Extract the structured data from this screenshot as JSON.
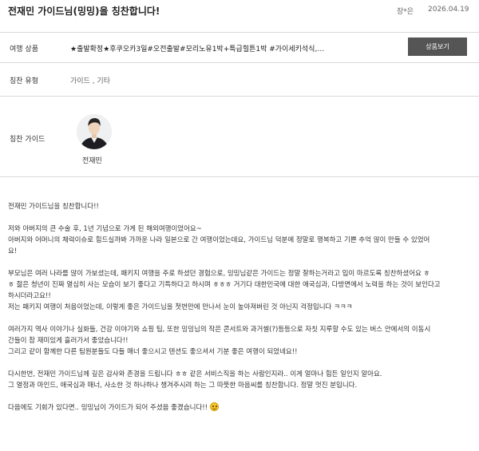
{
  "header": {
    "title": "전재민 가이드님(밍밍)을 칭찬합니다!",
    "author": "장*은",
    "date": "2026.04.19"
  },
  "product": {
    "label": "여행 상품",
    "value": "★출발확정★후쿠오카3일#오전출발#모리노유1박+특급힐튼1박 #가이세키석식,벳...",
    "button_label": "상품보기"
  },
  "praise_type": {
    "label": "칭찬 유형",
    "value": "가이드 , 기타"
  },
  "guide": {
    "label": "칭찬 가이드",
    "name": "전재민"
  },
  "body": {
    "lines": [
      "전재민 가이드님을 칭찬합니다!!",
      "저와 아버지의 큰 수술 후, 1년 기념으로 가게 된 해외여행이었어요~",
      "아버지와 어머니의 체력이슈로 힘드실까봐 가까운 나라 일본으로 간 여행이었는데요, 가이드님 덕분에 정말로 행복하고 기쁜 추억 많이 만들 수 있었어",
      "요!",
      "부모님은 여러 나라를 많이 가보셨는데, 패키지 여행을 주로 하셨던 경험으로, 밍밍님같은 가이드는 정말 잘하는거라고 입이 마르도록 칭찬하셨어요 ㅎ",
      "ㅎ 젊은 청년이 진짜 열심히 사는 모습이 보기 좋다고 기특하다고 하시며 ㅎㅎㅎ 거기다 대한민국에 대한 애국심과, 다방면에서 노력을 하는 것이 보인다고",
      "하시더라고요!!",
      "저는 패키지 여행이 처음이었는데, 이렇게 좋은 가이드님을 첫번만에 만나서 눈이 높아져버린 것 아닌지 걱정입니다 ㅋㅋㅋ",
      "여러가지 역사 이야기나 실화들, 건강 이야기와 쇼핑 팁, 또한 밍밍님의 작은 콘서트와 과거썰(?)등등으로 자칫 지루할 수도 있는 버스 안에서의 이동시",
      "간들이 참 재미있게 흘러가서 좋았습니다!!",
      "그리고 같이 함께한 다른 팀원분들도 다들 매너 좋으시고 텐션도 좋으셔서 기분 좋은 여행이 되었네요!!",
      "다시한번, 전재민 가이드님께 깊은 감사와 존경을 드립니다 ㅎㅎ 같은 서비스직을 하는 사람인지라.. 이게 얼마나 힘든 일인지 알아요.",
      "그 열정과 마인드, 애국심과 매너, 사소한 것 하나하나 챙겨주시려 하는 그 따뜻한 마음씨를 칭찬합니다. 정말 멋진 분입니다.",
      "다음에도 기회가 있다면.. 밍밍님이 가이드가 되어 주셨음 좋겠습니다!!"
    ],
    "emoji_icon": "smiling-face-icon"
  }
}
